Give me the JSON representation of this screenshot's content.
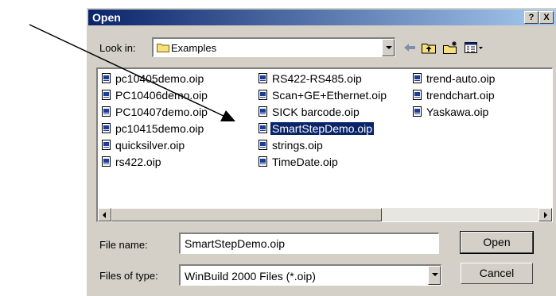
{
  "dialog": {
    "title": "Open",
    "help_label": "?",
    "close_label": "X"
  },
  "look_in": {
    "label": "Look in:",
    "value": "Examples"
  },
  "files": [
    {
      "name": "pc10405demo.oip",
      "selected": false
    },
    {
      "name": "PC10406demo.oip",
      "selected": false
    },
    {
      "name": "PC10407demo.oip",
      "selected": false
    },
    {
      "name": "pc10415demo.oip",
      "selected": false
    },
    {
      "name": "quicksilver.oip",
      "selected": false
    },
    {
      "name": "rs422.oip",
      "selected": false
    },
    {
      "name": "RS422-RS485.oip",
      "selected": false
    },
    {
      "name": "Scan+GE+Ethernet.oip",
      "selected": false
    },
    {
      "name": "SICK barcode.oip",
      "selected": false
    },
    {
      "name": "SmartStepDemo.oip",
      "selected": true
    },
    {
      "name": "strings.oip",
      "selected": false
    },
    {
      "name": "TimeDate.oip",
      "selected": false
    },
    {
      "name": "trend-auto.oip",
      "selected": false
    },
    {
      "name": "trendchart.oip",
      "selected": false
    },
    {
      "name": "Yaskawa.oip",
      "selected": false
    }
  ],
  "file_name": {
    "label": "File name:",
    "value": "SmartStepDemo.oip"
  },
  "file_type": {
    "label": "Files of type:",
    "value": "WinBuild 2000 Files (*.oip)"
  },
  "buttons": {
    "open": "Open",
    "cancel": "Cancel"
  },
  "icons": [
    "folder-icon",
    "back-arrow-icon",
    "up-folder-icon",
    "new-folder-icon",
    "view-menu-icon",
    "file-icon"
  ],
  "colors": {
    "titlebar_start": "#0a246a",
    "titlebar_end": "#a6caf0",
    "selection": "#0a246a",
    "dialog_face": "#d4d0c8"
  }
}
